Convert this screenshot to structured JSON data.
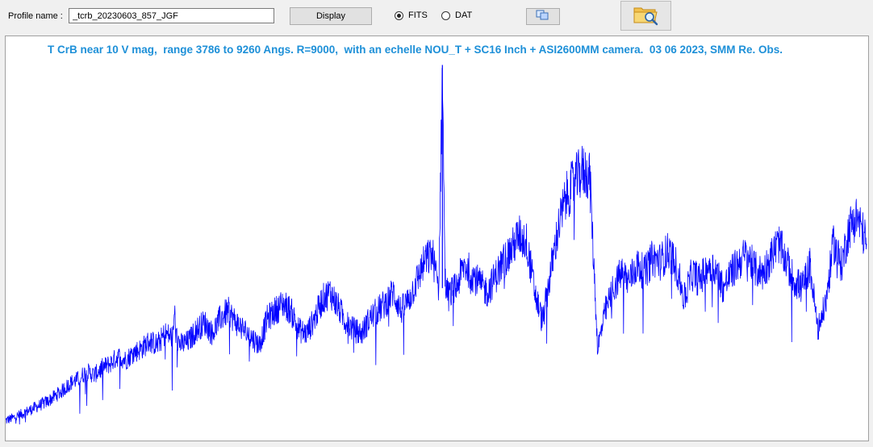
{
  "toolbar": {
    "profile_label": "Profile name :",
    "profile_value": "_tcrb_20230603_857_JGF",
    "display_label": "Display",
    "format_options": [
      {
        "label": "FITS",
        "checked": true
      },
      {
        "label": "DAT",
        "checked": false
      }
    ],
    "copy_icon": "copy-icon",
    "open_icon": "folder-search-icon"
  },
  "chart_data": {
    "type": "line",
    "title": "T CrB near 10 V mag,  range 3786 to 9260 Angs. R=9000,  with an echelle NOU_T + SC16 Inch + ASI2600MM camera.  03 06 2023, SMM Re. Obs.",
    "xlim": [
      3786,
      9260
    ],
    "ylim": [
      0,
      1
    ],
    "grid": false,
    "series": [
      {
        "color": "#0000ff",
        "x": [
          3786,
          3850,
          3950,
          4050,
          4150,
          4200,
          4250,
          4300,
          4350,
          4400,
          4450,
          4500,
          4550,
          4600,
          4650,
          4700,
          4750,
          4800,
          4850,
          4860,
          4870,
          4900,
          4950,
          5000,
          5050,
          5100,
          5150,
          5200,
          5250,
          5300,
          5350,
          5400,
          5450,
          5500,
          5550,
          5600,
          5650,
          5700,
          5750,
          5800,
          5850,
          5900,
          5950,
          6000,
          6050,
          6100,
          6150,
          6200,
          6250,
          6300,
          6350,
          6400,
          6450,
          6500,
          6520,
          6540,
          6563,
          6580,
          6600,
          6650,
          6700,
          6750,
          6800,
          6850,
          6900,
          6950,
          7000,
          7050,
          7100,
          7150,
          7200,
          7250,
          7300,
          7350,
          7400,
          7450,
          7500,
          7550,
          7600,
          7650,
          7700,
          7750,
          7800,
          7850,
          7900,
          7950,
          8000,
          8050,
          8100,
          8150,
          8200,
          8250,
          8300,
          8350,
          8400,
          8450,
          8500,
          8550,
          8600,
          8650,
          8700,
          8750,
          8800,
          8850,
          8900,
          8950,
          9000,
          9050,
          9100,
          9150,
          9200,
          9260
        ],
        "y": [
          0.01,
          0.02,
          0.04,
          0.06,
          0.09,
          0.11,
          0.12,
          0.14,
          0.13,
          0.15,
          0.16,
          0.18,
          0.17,
          0.19,
          0.2,
          0.22,
          0.21,
          0.24,
          0.23,
          0.3,
          0.23,
          0.21,
          0.22,
          0.25,
          0.27,
          0.24,
          0.28,
          0.3,
          0.27,
          0.25,
          0.23,
          0.21,
          0.28,
          0.3,
          0.32,
          0.3,
          0.25,
          0.24,
          0.28,
          0.33,
          0.35,
          0.31,
          0.27,
          0.25,
          0.24,
          0.28,
          0.3,
          0.32,
          0.35,
          0.3,
          0.33,
          0.38,
          0.43,
          0.45,
          0.4,
          0.36,
          0.95,
          0.38,
          0.34,
          0.36,
          0.42,
          0.4,
          0.37,
          0.35,
          0.39,
          0.43,
          0.46,
          0.5,
          0.48,
          0.35,
          0.27,
          0.4,
          0.52,
          0.6,
          0.64,
          0.67,
          0.66,
          0.2,
          0.3,
          0.36,
          0.4,
          0.38,
          0.42,
          0.4,
          0.44,
          0.43,
          0.46,
          0.42,
          0.33,
          0.4,
          0.38,
          0.42,
          0.41,
          0.36,
          0.4,
          0.43,
          0.45,
          0.41,
          0.4,
          0.44,
          0.48,
          0.43,
          0.38,
          0.36,
          0.42,
          0.25,
          0.32,
          0.48,
          0.42,
          0.52,
          0.55,
          0.48
        ]
      }
    ]
  }
}
